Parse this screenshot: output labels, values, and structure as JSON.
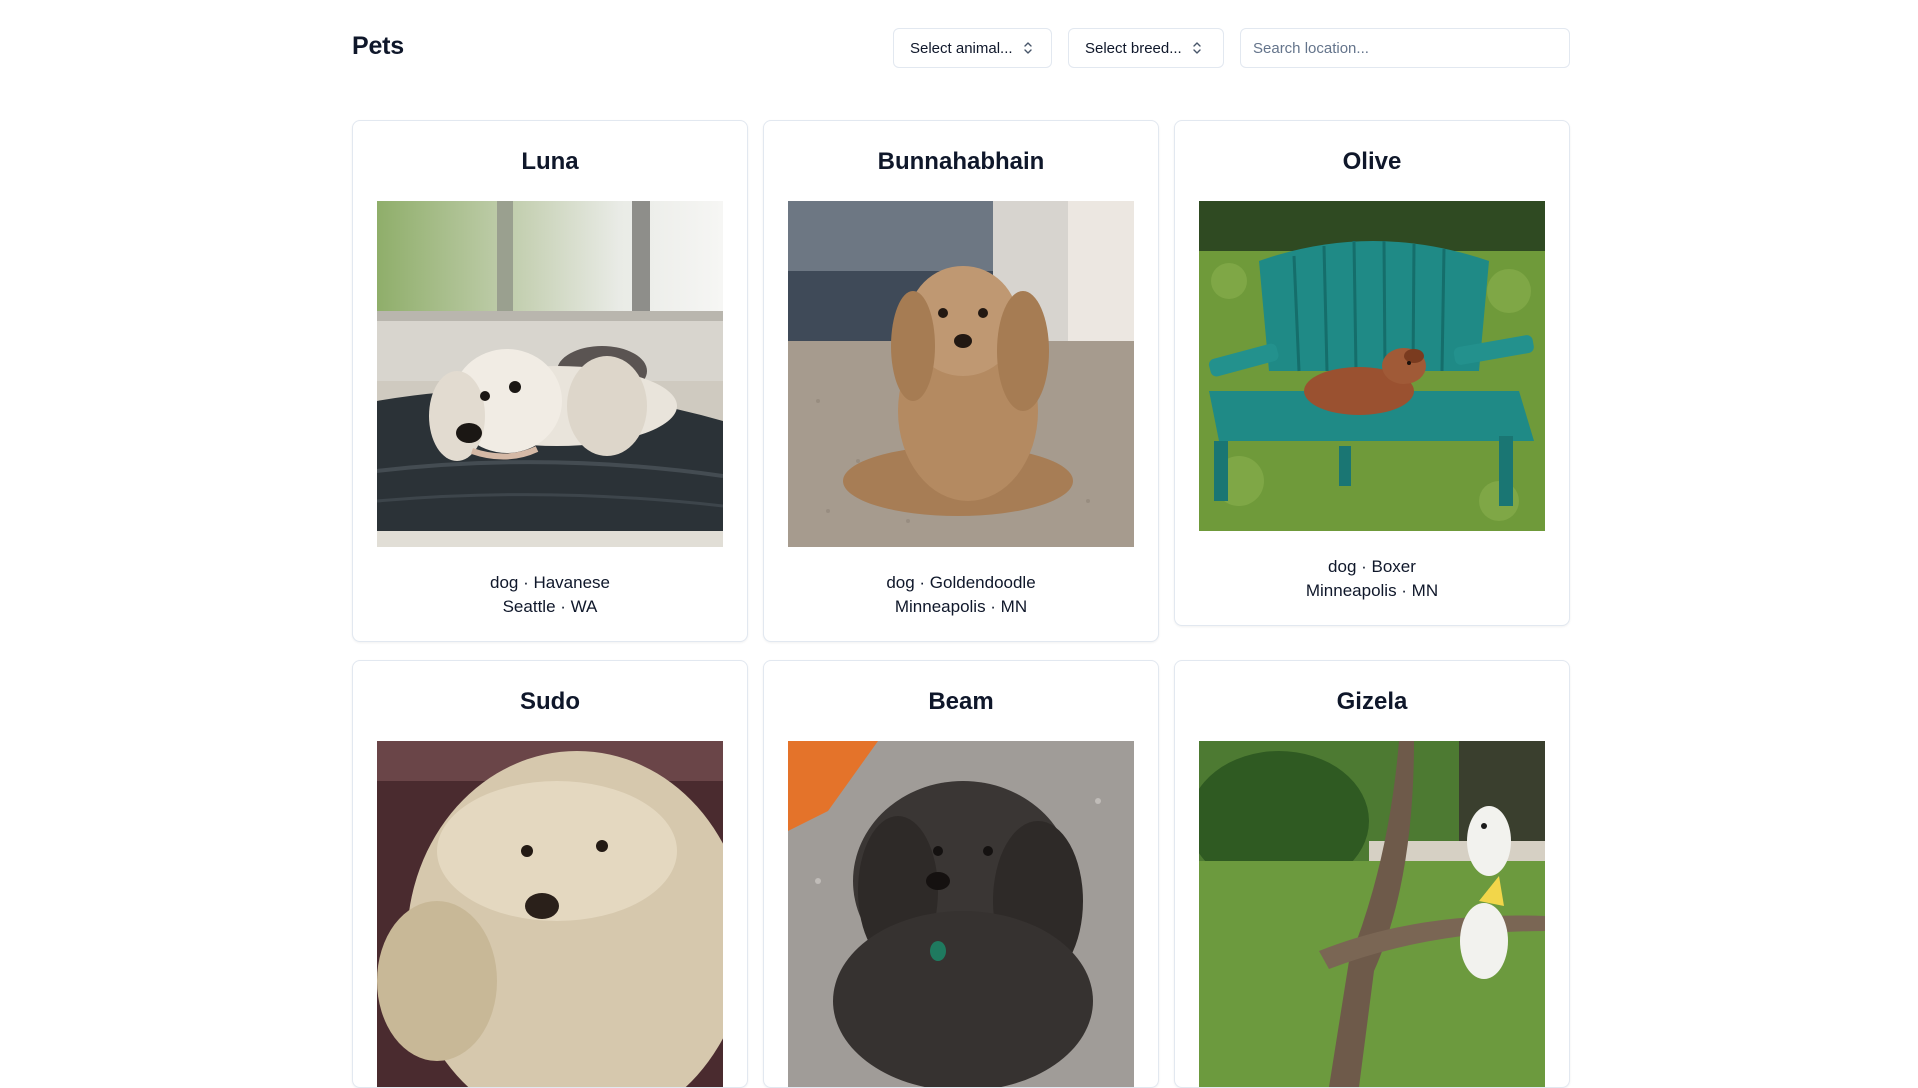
{
  "header": {
    "title": "Pets",
    "animal_select_label": "Select animal...",
    "breed_select_label": "Select breed...",
    "search_placeholder": "Search location..."
  },
  "pets": [
    {
      "name": "Luna",
      "species_breed": "dog · Havanese",
      "location": "Seattle · WA"
    },
    {
      "name": "Bunnahabhain",
      "species_breed": "dog · Goldendoodle",
      "location": "Minneapolis · MN"
    },
    {
      "name": "Olive",
      "species_breed": "dog · Boxer",
      "location": "Minneapolis · MN"
    },
    {
      "name": "Sudo"
    },
    {
      "name": "Beam"
    },
    {
      "name": "Gizela"
    }
  ]
}
